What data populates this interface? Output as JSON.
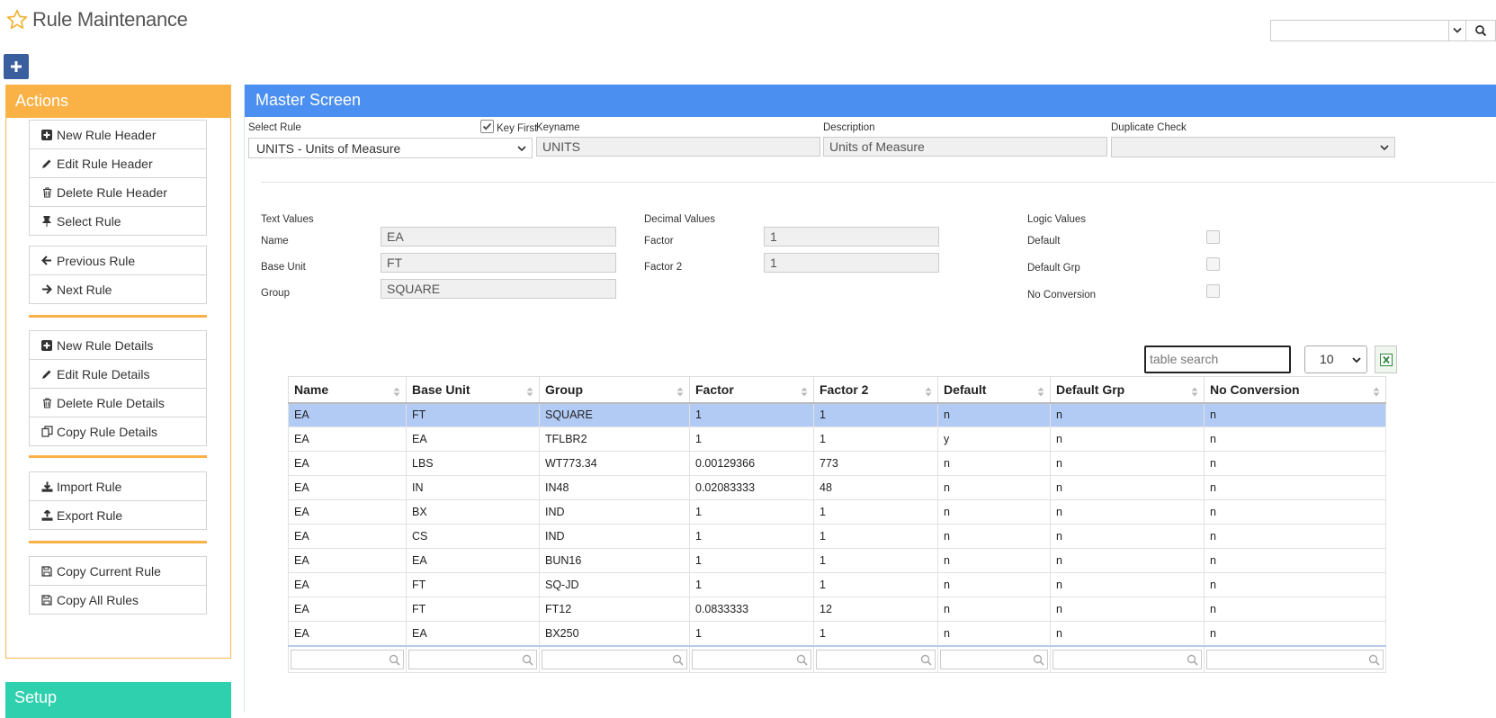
{
  "header": {
    "title": "Rule Maintenance"
  },
  "actions": {
    "title": "Actions",
    "groups": [
      [
        "New Rule Header",
        "Edit Rule Header",
        "Delete Rule Header",
        "Select Rule"
      ],
      [
        "Previous Rule",
        "Next Rule"
      ],
      [
        "New Rule Details",
        "Edit Rule Details",
        "Delete Rule Details",
        "Copy Rule Details"
      ],
      [
        "Import Rule",
        "Export Rule"
      ],
      [
        "Copy Current Rule",
        "Copy All Rules"
      ]
    ]
  },
  "setup": {
    "title": "Setup"
  },
  "master": {
    "title": "Master Screen",
    "select_rule_label": "Select Rule",
    "select_rule_value": "UNITS - Units of Measure",
    "key_first_label": "Key First",
    "keyname_label": "Keyname",
    "keyname_value": "UNITS",
    "description_label": "Description",
    "description_value": "Units of Measure",
    "duplicate_check_label": "Duplicate Check",
    "duplicate_check_value": ""
  },
  "details": {
    "text_values_label": "Text Values",
    "decimal_values_label": "Decimal Values",
    "logic_values_label": "Logic Values",
    "name_label": "Name",
    "name_value": "EA",
    "base_unit_label": "Base Unit",
    "base_unit_value": "FT",
    "group_label": "Group",
    "group_value": "SQUARE",
    "factor_label": "Factor",
    "factor_value": "1",
    "factor2_label": "Factor 2",
    "factor2_value": "1",
    "default_label": "Default",
    "default_grp_label": "Default Grp",
    "no_conversion_label": "No Conversion"
  },
  "table": {
    "search_placeholder": "table search",
    "page_size": "10",
    "columns": [
      "Name",
      "Base Unit",
      "Group",
      "Factor",
      "Factor 2",
      "Default",
      "Default Grp",
      "No Conversion"
    ],
    "rows": [
      [
        "EA",
        "FT",
        "SQUARE",
        "1",
        "1",
        "n",
        "n",
        "n"
      ],
      [
        "EA",
        "EA",
        "TFLBR2",
        "1",
        "1",
        "y",
        "n",
        "n"
      ],
      [
        "EA",
        "LBS",
        "WT773.34",
        "0.00129366",
        "773",
        "n",
        "n",
        "n"
      ],
      [
        "EA",
        "IN",
        "IN48",
        "0.02083333",
        "48",
        "n",
        "n",
        "n"
      ],
      [
        "EA",
        "BX",
        "IND",
        "1",
        "1",
        "n",
        "n",
        "n"
      ],
      [
        "EA",
        "CS",
        "IND",
        "1",
        "1",
        "n",
        "n",
        "n"
      ],
      [
        "EA",
        "EA",
        "BUN16",
        "1",
        "1",
        "n",
        "n",
        "n"
      ],
      [
        "EA",
        "FT",
        "SQ-JD",
        "1",
        "1",
        "n",
        "n",
        "n"
      ],
      [
        "EA",
        "FT",
        "FT12",
        "0.0833333",
        "12",
        "n",
        "n",
        "n"
      ],
      [
        "EA",
        "EA",
        "BX250",
        "1",
        "1",
        "n",
        "n",
        "n"
      ]
    ]
  },
  "colors": {
    "actions": "#fab247",
    "master": "#4b8ff0",
    "setup": "#2fd0ad",
    "selected_row": "#b2cbf5"
  }
}
